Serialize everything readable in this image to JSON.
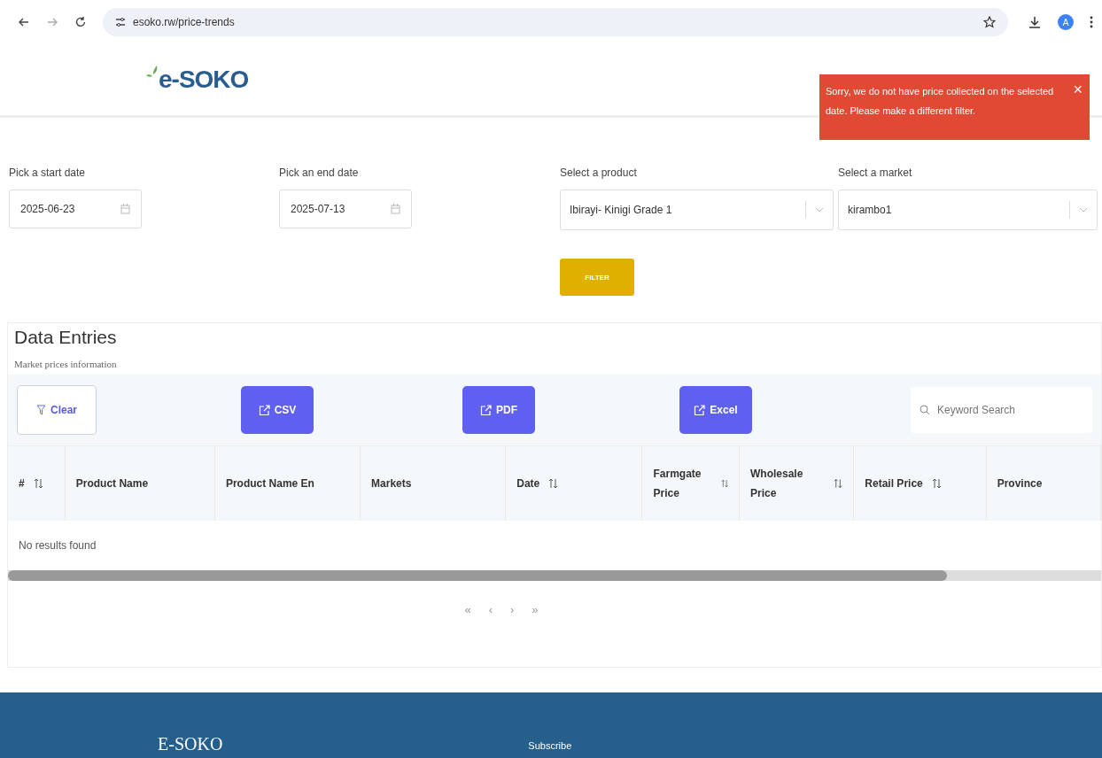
{
  "browser": {
    "url": "esoko.rw/price-trends",
    "avatar": "A"
  },
  "header": {
    "logo": "e-SOKO"
  },
  "toast": {
    "message": "Sorry, we do not have price collected on the selected date. Please make a different filter.",
    "close": "×"
  },
  "filters": [
    {
      "kind": "date",
      "label": "Pick a start date",
      "value": "2025-06-23"
    },
    {
      "kind": "date",
      "label": "Pick an end date",
      "value": "2025-07-13"
    },
    {
      "kind": "select",
      "label": "Select a product",
      "value": "Ibirayi- Kinigi Grade 1"
    },
    {
      "kind": "select",
      "label": "Select a market",
      "value": "kirambo1"
    }
  ],
  "filter_button": "FILTER",
  "data_entries": {
    "title": "Data Entries",
    "subtitle": "Market prices information",
    "toolbar": [
      {
        "kind": "clear",
        "label": "Clear"
      },
      {
        "kind": "export",
        "label": "CSV"
      },
      {
        "kind": "export",
        "label": "PDF"
      },
      {
        "kind": "export",
        "label": "Excel"
      }
    ],
    "search": {
      "placeholder": "Keyword Search"
    },
    "table": {
      "columns": [
        {
          "label": "#",
          "sortable": true
        },
        {
          "label": "Product Name",
          "sortable": false
        },
        {
          "label": "Product Name En",
          "sortable": false
        },
        {
          "label": "Markets",
          "sortable": false
        },
        {
          "label": "Date",
          "sortable": true
        },
        {
          "label": "Farmgate Price",
          "sortable": true
        },
        {
          "label": "Wholesale Price",
          "sortable": true
        },
        {
          "label": "Retail Price",
          "sortable": true
        },
        {
          "label": "Province",
          "sortable": false
        }
      ],
      "empty_message": "No results found"
    },
    "pagination": [
      "«",
      "‹",
      "›",
      "»"
    ]
  },
  "footer": {
    "brand": "E-SOKO",
    "subscribe": "Subscribe"
  }
}
